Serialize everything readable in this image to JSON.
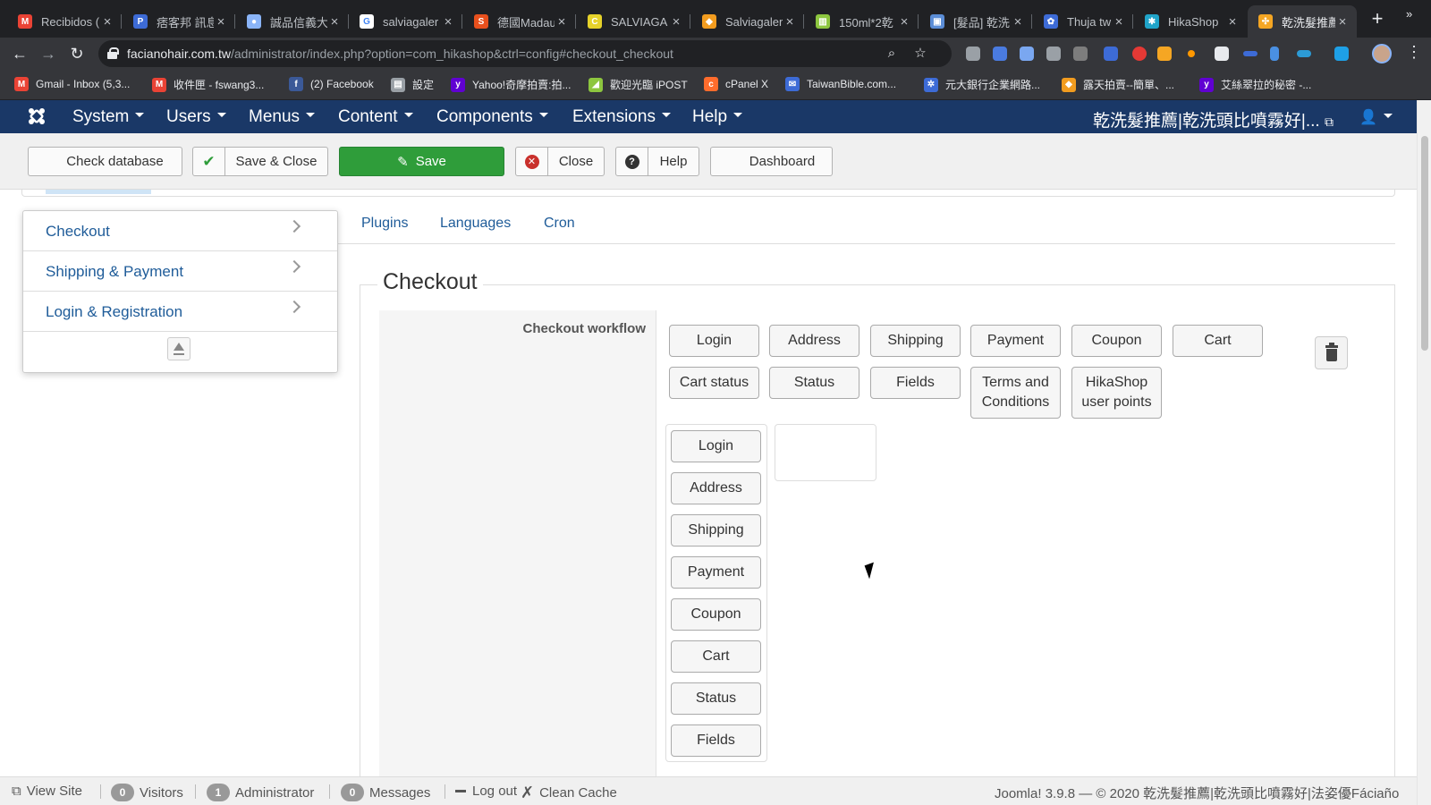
{
  "browser": {
    "tabs": [
      {
        "label": "Recibidos (",
        "icon": "gmail-icon",
        "color": "#ea4335",
        "glyph": "M"
      },
      {
        "label": "痞客邦 訊息",
        "icon": "pixnet-icon",
        "color": "#3d6bd6",
        "glyph": "P"
      },
      {
        "label": "誠品信義大",
        "icon": "eslite-icon",
        "color": "#8ab4f8",
        "glyph": "●"
      },
      {
        "label": "salviagaler",
        "icon": "google-icon",
        "color": "#ffffff",
        "glyph": "G"
      },
      {
        "label": "德國Madau",
        "icon": "shopee-icon",
        "color": "#e8501d",
        "glyph": "S"
      },
      {
        "label": "SALVIAGA",
        "icon": "lazada-icon",
        "color": "#e6d22a",
        "glyph": "C"
      },
      {
        "label": "Salviagaler",
        "icon": "ruten-icon",
        "color": "#f29c1f",
        "glyph": "◆"
      },
      {
        "label": "150ml*2乾",
        "icon": "sheets-icon",
        "color": "#8dc63f",
        "glyph": "▥"
      },
      {
        "label": "[髮品] 乾洗",
        "icon": "page-icon",
        "color": "#5b8dd6",
        "glyph": "▣"
      },
      {
        "label": "Thuja twig",
        "icon": "wiki-icon",
        "color": "#3d6bd6",
        "glyph": "✿"
      },
      {
        "label": "HikaShop",
        "icon": "hikashop-icon",
        "color": "#20a4c9",
        "glyph": "✱"
      },
      {
        "label": "乾洗髮推薦",
        "icon": "joomla-tab-icon",
        "color": "#f5a623",
        "glyph": "✣"
      }
    ],
    "url_host": "facianohair.com.tw",
    "url_path": "/administrator/index.php?option=com_hikashop&ctrl=config#checkout_checkout",
    "bookmarks": [
      {
        "label": "Gmail - Inbox (5,3...",
        "icon": "gmail-icon",
        "color": "#ea4335",
        "glyph": "M"
      },
      {
        "label": "收件匣 - fswang3...",
        "icon": "gmail-icon",
        "color": "#ea4335",
        "glyph": "M"
      },
      {
        "label": "(2) Facebook",
        "icon": "facebook-icon",
        "color": "#3b5998",
        "glyph": "f"
      },
      {
        "label": "設定",
        "icon": "printer-icon",
        "color": "#9aa0a6",
        "glyph": "▤"
      },
      {
        "label": "Yahoo!奇摩拍賣:拍...",
        "icon": "yahoo-icon",
        "color": "#6001d2",
        "glyph": "y"
      },
      {
        "label": "歡迎光臨 iPOST",
        "icon": "ipost-icon",
        "color": "#8dc63f",
        "glyph": "◢"
      },
      {
        "label": "cPanel X",
        "icon": "cpanel-icon",
        "color": "#ff6c2c",
        "glyph": "c"
      },
      {
        "label": "TaiwanBible.com...",
        "icon": "mail-icon",
        "color": "#3d6bd6",
        "glyph": "✉"
      },
      {
        "label": "元大銀行企業網路...",
        "icon": "bank-icon",
        "color": "#3d6bd6",
        "glyph": "✲"
      },
      {
        "label": "露天拍賣--簡單、...",
        "icon": "ruten-icon",
        "color": "#f29c1f",
        "glyph": "◆"
      },
      {
        "label": "艾絲翠拉的秘密 -...",
        "icon": "yahoo-icon",
        "color": "#6001d2",
        "glyph": "y"
      }
    ]
  },
  "joomla": {
    "menu": [
      "System",
      "Users",
      "Menus",
      "Content",
      "Components",
      "Extensions",
      "Help"
    ],
    "site_title": "乾洗髮推薦|乾洗頭比噴霧好|...",
    "toolbar": {
      "check_database": "Check database",
      "save_close": "Save & Close",
      "save": "Save",
      "close": "Close",
      "help": "Help",
      "dashboard": "Dashboard"
    },
    "colors": {
      "navbar": "#1a3867",
      "save_green": "#2f9d3a",
      "link": "#1f5c99"
    }
  },
  "config": {
    "side_menu": [
      "Checkout",
      "Shipping & Payment",
      "Login & Registration"
    ],
    "sub_tabs": [
      "Plugins",
      "Languages",
      "Cron"
    ],
    "section_title": "Checkout",
    "workflow_label": "Checkout workflow",
    "available_blocks": [
      "Login",
      "Address",
      "Shipping",
      "Payment",
      "Coupon",
      "Cart",
      "Cart status",
      "Status",
      "Fields",
      "Terms and Conditions",
      "HikaShop user points"
    ],
    "workflow_column_blocks": [
      "Login",
      "Address",
      "Shipping",
      "Payment",
      "Coupon",
      "Cart",
      "Status",
      "Fields"
    ]
  },
  "status_bar": {
    "view_site": "View Site",
    "visitors_count": "0",
    "visitors_label": "Visitors",
    "admins_count": "1",
    "admins_label": "Administrator",
    "messages_count": "0",
    "messages_label": "Messages",
    "logout": "Log out",
    "clean_cache": "Clean Cache",
    "footer": "Joomla! 3.9.8  —  © 2020 乾洗髮推薦|乾洗頭比噴霧好|法姿優Fáciaño"
  }
}
